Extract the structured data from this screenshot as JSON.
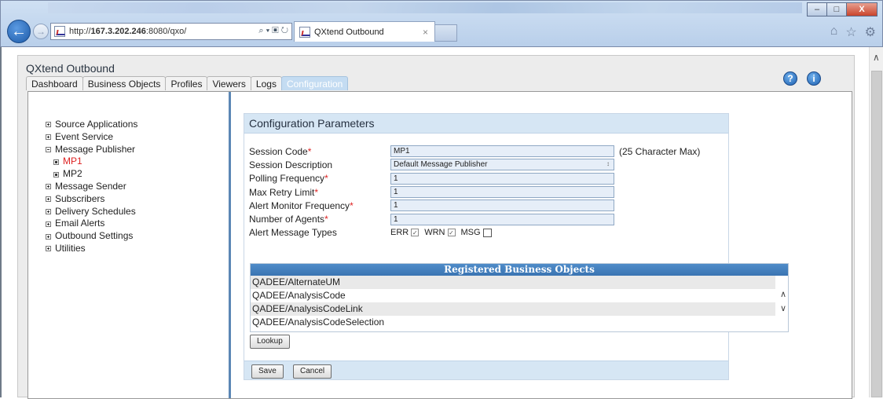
{
  "browser": {
    "url_prefix": "http://",
    "url_host": "167.3.202.246",
    "url_rest": ":8080/qxo/",
    "addr_tools": "⌕ ▾ ▣ ↻",
    "tab_title": "QXtend Outbound",
    "tab_close": "×",
    "win_min": "–",
    "win_max": "□",
    "win_close": "X",
    "back": "←",
    "forward": "→",
    "home_icon": "⌂",
    "star_icon": "☆",
    "gear_icon": "⚙"
  },
  "app": {
    "title": "QXtend Outbound",
    "tabs": [
      "Dashboard",
      "Business Objects",
      "Profiles",
      "Viewers",
      "Logs",
      "Configuration"
    ],
    "active_tab": "Configuration",
    "help_icon": "?",
    "info_icon": "i"
  },
  "sidebar": {
    "items": [
      {
        "label": "Source Applications",
        "state": "collapsed"
      },
      {
        "label": "Event Service",
        "state": "collapsed"
      },
      {
        "label": "Message Publisher",
        "state": "expanded"
      },
      {
        "label": "MP1",
        "state": "leaf-active"
      },
      {
        "label": "MP2",
        "state": "leaf"
      },
      {
        "label": "Message Sender",
        "state": "collapsed"
      },
      {
        "label": "Subscribers",
        "state": "collapsed"
      },
      {
        "label": "Delivery Schedules",
        "state": "collapsed"
      },
      {
        "label": "Email Alerts",
        "state": "collapsed"
      },
      {
        "label": "Outbound Settings",
        "state": "collapsed"
      },
      {
        "label": "Utilities",
        "state": "collapsed"
      }
    ]
  },
  "panel": {
    "title": "Configuration Parameters",
    "fields": {
      "session_code": {
        "label": "Session Code",
        "required": "*",
        "value": "MP1",
        "hint": "(25 Character Max)"
      },
      "session_description": {
        "label": "Session Description",
        "value": "Default Message Publisher",
        "spin": "↕"
      },
      "polling_frequency": {
        "label": "Polling Frequency",
        "required": "*",
        "value": "1"
      },
      "max_retry_limit": {
        "label": "Max Retry Limit",
        "required": "*",
        "value": "1"
      },
      "alert_monitor_frequency": {
        "label": "Alert Monitor Frequency",
        "required": "*",
        "value": "1"
      },
      "number_of_agents": {
        "label": "Number of Agents",
        "required": "*",
        "value": "1"
      },
      "alert_message_types": {
        "label": "Alert Message Types",
        "options": [
          {
            "label": "ERR",
            "checked": true,
            "mark": "✓"
          },
          {
            "label": "WRN",
            "checked": true,
            "mark": "✓"
          },
          {
            "label": "MSG",
            "checked": false,
            "mark": ""
          }
        ]
      }
    },
    "registered": {
      "title": "Registered Business Objects",
      "items": [
        "QADEE/AlternateUM",
        "QADEE/AnalysisCode",
        "QADEE/AnalysisCodeLink",
        "QADEE/AnalysisCodeSelection"
      ],
      "scroll_up": "∧",
      "scroll_down": "∨"
    },
    "lookup_label": "Lookup",
    "save_label": "Save",
    "cancel_label": "Cancel"
  },
  "page_scroll_up": "∧"
}
